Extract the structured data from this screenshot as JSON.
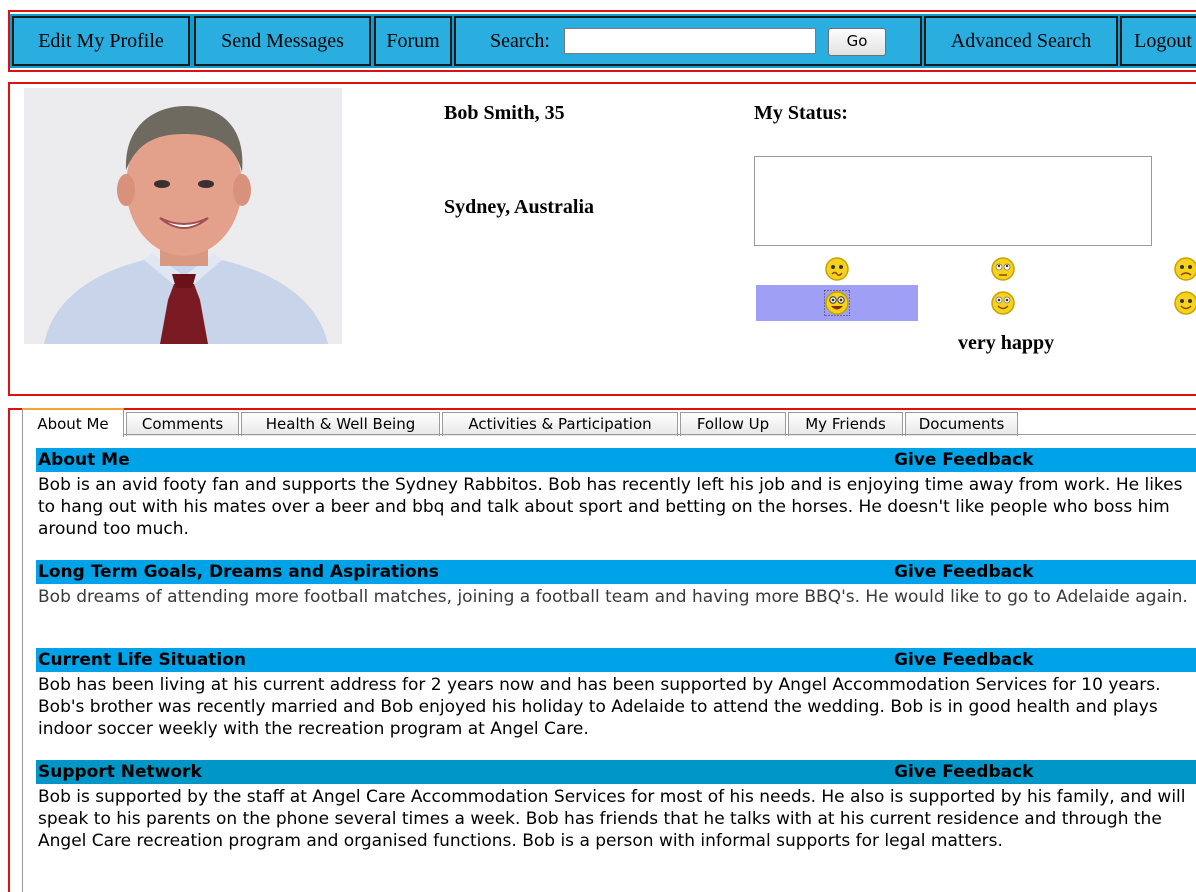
{
  "nav": {
    "edit_profile": "Edit My Profile",
    "send_messages": "Send Messages",
    "forum": "Forum",
    "search_label": "Search:",
    "search_value": "",
    "go": "Go",
    "advanced_search": "Advanced Search",
    "logout": "Logout"
  },
  "profile": {
    "name_age": "Bob Smith, 35",
    "location": "Sydney, Australia",
    "status_label": "My Status:",
    "status_text": "",
    "mood_selected": "very happy",
    "mood_icons": [
      "confused-face-icon",
      "rolling-eyes-face-icon",
      "sad-face-icon",
      "very-happy-face-icon",
      "happy-face-icon",
      "smile-face-icon"
    ]
  },
  "tabs": [
    "About Me",
    "Comments",
    "Health & Well Being",
    "Activities & Participation",
    "Follow Up",
    "My Friends",
    "Documents"
  ],
  "active_tab": "About Me",
  "sections": [
    {
      "title": "About Me",
      "feedback": "Give Feedback",
      "body": "Bob is an avid footy fan and supports the Sydney Rabbitos. Bob has recently left his job and is enjoying time away from work. He likes to hang out with his mates over a beer and bbq and talk about sport and betting on the horses. He doesn't like people who boss him around too much."
    },
    {
      "title": "Long Term Goals, Dreams and Aspirations",
      "feedback": "Give Feedback",
      "body": "Bob dreams of attending more football matches, joining a football team and having more BBQ's. He would like to go to Adelaide again."
    },
    {
      "title": "Current Life Situation",
      "feedback": "Give Feedback",
      "body": "Bob has been living at his current address for 2 years now and has been supported by Angel Accommodation Services for 10 years. Bob's brother was recently married and Bob enjoyed his holiday to Adelaide to attend the wedding. Bob is in good health and plays indoor soccer weekly with the recreation program at Angel Care."
    },
    {
      "title": "Support Network",
      "feedback": "Give Feedback",
      "body": "Bob is supported by the staff at Angel Care Accommodation Services for most of his needs. He also is supported by his family, and will speak to his parents on the phone several times a week. Bob has friends that he talks with at his current residence and through the Angel Care recreation program and organised functions. Bob is a person with informal supports for legal matters."
    }
  ],
  "colors": {
    "nav_bg": "#0b9fd0",
    "section_header": "#00a2e8",
    "section_header_alt": "#0096c8",
    "frame_border": "#e01010",
    "mood_highlight": "#9f9ff6",
    "tab_active_accent": "#f2a62e"
  }
}
